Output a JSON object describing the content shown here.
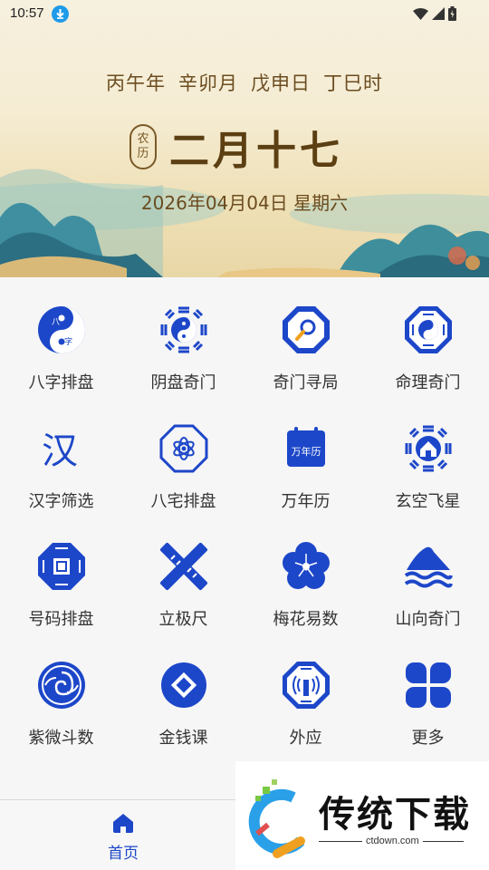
{
  "status_bar": {
    "time": "10:57"
  },
  "header": {
    "ganzhi": [
      "丙午年",
      "辛卯月",
      "戊申日",
      "丁巳时"
    ],
    "lunar_badge": [
      "农",
      "历"
    ],
    "lunar_date": "二月十七",
    "solar_date": "2026年04月04日 星期六"
  },
  "tools": [
    {
      "label": "八字排盘",
      "icon": "bazi-yinyang-icon",
      "glyph": [
        "八",
        "字"
      ]
    },
    {
      "label": "阴盘奇门",
      "icon": "bagua-yinyang-icon"
    },
    {
      "label": "奇门寻局",
      "icon": "octagon-search-icon"
    },
    {
      "label": "命理奇门",
      "icon": "bagua-octagon-icon"
    },
    {
      "label": "汉字筛选",
      "icon": "hanzi-icon",
      "glyph": "汉"
    },
    {
      "label": "八宅排盘",
      "icon": "house-atom-icon"
    },
    {
      "label": "万年历",
      "icon": "calendar-icon",
      "glyph": "万年历"
    },
    {
      "label": "玄空飞星",
      "icon": "bagua-house-icon"
    },
    {
      "label": "号码排盘",
      "icon": "octagon-seal-icon"
    },
    {
      "label": "立极尺",
      "icon": "ruler-icon"
    },
    {
      "label": "梅花易数",
      "icon": "plum-blossom-icon"
    },
    {
      "label": "山向奇门",
      "icon": "mountain-wave-icon"
    },
    {
      "label": "紫微斗数",
      "icon": "spiral-medallion-icon"
    },
    {
      "label": "金钱课",
      "icon": "coin-icon"
    },
    {
      "label": "外应",
      "icon": "octagon-signal-icon"
    },
    {
      "label": "更多",
      "icon": "more-grid-icon"
    }
  ],
  "bottom_nav": {
    "home_label": "首页",
    "home_icon": "home-icon"
  },
  "watermark": {
    "brand": "传统下载",
    "url": "ctdown.com"
  },
  "colors": {
    "accent": "#1d47c9",
    "header_text": "#6b4c1f"
  }
}
